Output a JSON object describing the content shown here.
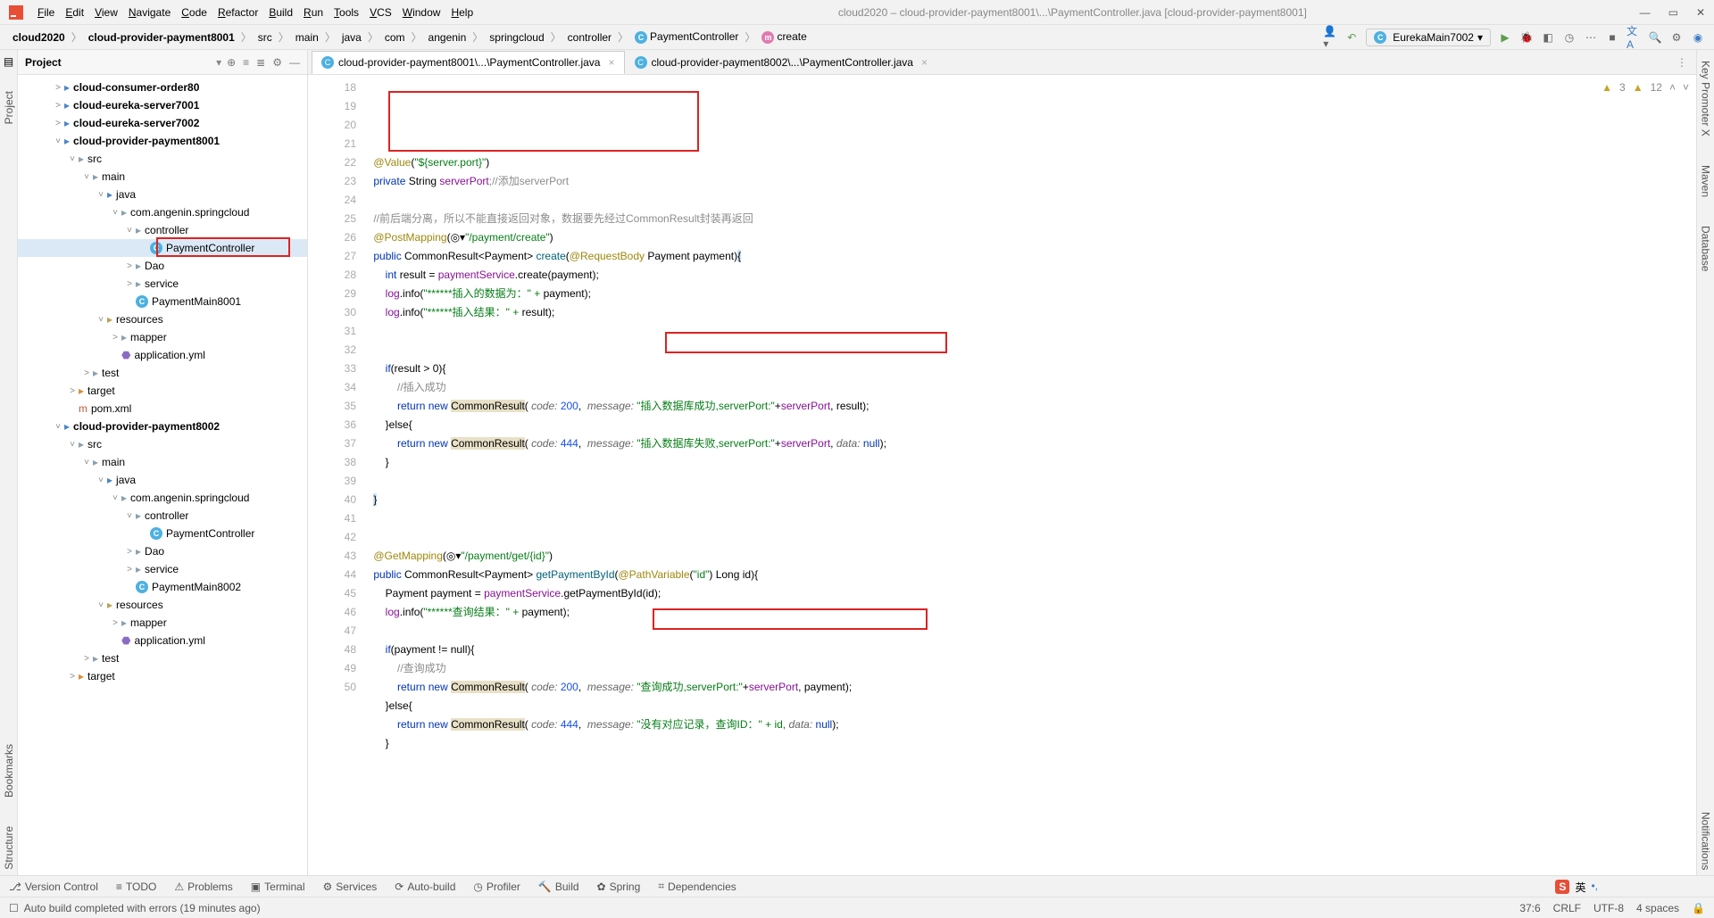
{
  "menu": {
    "items": [
      "File",
      "Edit",
      "View",
      "Navigate",
      "Code",
      "Refactor",
      "Build",
      "Run",
      "Tools",
      "VCS",
      "Window",
      "Help"
    ],
    "title": "cloud2020 – cloud-provider-payment8001\\...\\PaymentController.java [cloud-provider-payment8001]"
  },
  "crumbs": [
    "cloud2020",
    "cloud-provider-payment8001",
    "src",
    "main",
    "java",
    "com",
    "angenin",
    "springcloud",
    "controller",
    "PaymentController",
    "create"
  ],
  "run_config": "EurekaMain7002",
  "project_header": "Project",
  "left_tabs": [
    "Project",
    "Bookmarks",
    "Structure"
  ],
  "right_tabs": [
    "Key Promoter X",
    "Maven",
    "Database",
    "Notifications"
  ],
  "tree": [
    {
      "d": 2,
      "a": ">",
      "i": "folder-src",
      "t": "cloud-consumer-order80",
      "bold": true
    },
    {
      "d": 2,
      "a": ">",
      "i": "folder-src",
      "t": "cloud-eureka-server7001",
      "bold": true
    },
    {
      "d": 2,
      "a": ">",
      "i": "folder-src",
      "t": "cloud-eureka-server7002",
      "bold": true
    },
    {
      "d": 2,
      "a": "v",
      "i": "folder-src",
      "t": "cloud-provider-payment8001",
      "bold": true
    },
    {
      "d": 3,
      "a": "v",
      "i": "folder",
      "t": "src"
    },
    {
      "d": 4,
      "a": "v",
      "i": "folder",
      "t": "main"
    },
    {
      "d": 5,
      "a": "v",
      "i": "folder-src",
      "t": "java"
    },
    {
      "d": 6,
      "a": "v",
      "i": "folder",
      "t": "com.angenin.springcloud"
    },
    {
      "d": 7,
      "a": "v",
      "i": "folder",
      "t": "controller"
    },
    {
      "d": 8,
      "a": "",
      "i": "file-c",
      "t": "PaymentController",
      "sel": true,
      "red": true
    },
    {
      "d": 7,
      "a": ">",
      "i": "folder",
      "t": "Dao"
    },
    {
      "d": 7,
      "a": ">",
      "i": "folder",
      "t": "service"
    },
    {
      "d": 7,
      "a": "",
      "i": "file-c",
      "t": "PaymentMain8001"
    },
    {
      "d": 5,
      "a": "v",
      "i": "folder-res",
      "t": "resources"
    },
    {
      "d": 6,
      "a": ">",
      "i": "folder",
      "t": "mapper"
    },
    {
      "d": 6,
      "a": "",
      "i": "file-yml",
      "t": "application.yml"
    },
    {
      "d": 4,
      "a": ">",
      "i": "folder",
      "t": "test"
    },
    {
      "d": 3,
      "a": ">",
      "i": "folder-ex",
      "t": "target"
    },
    {
      "d": 3,
      "a": "",
      "i": "file-m",
      "t": "pom.xml"
    },
    {
      "d": 2,
      "a": "v",
      "i": "folder-src",
      "t": "cloud-provider-payment8002",
      "bold": true
    },
    {
      "d": 3,
      "a": "v",
      "i": "folder",
      "t": "src"
    },
    {
      "d": 4,
      "a": "v",
      "i": "folder",
      "t": "main"
    },
    {
      "d": 5,
      "a": "v",
      "i": "folder-src",
      "t": "java"
    },
    {
      "d": 6,
      "a": "v",
      "i": "folder",
      "t": "com.angenin.springcloud"
    },
    {
      "d": 7,
      "a": "v",
      "i": "folder",
      "t": "controller"
    },
    {
      "d": 8,
      "a": "",
      "i": "file-c",
      "t": "PaymentController"
    },
    {
      "d": 7,
      "a": ">",
      "i": "folder",
      "t": "Dao"
    },
    {
      "d": 7,
      "a": ">",
      "i": "folder",
      "t": "service"
    },
    {
      "d": 7,
      "a": "",
      "i": "file-c",
      "t": "PaymentMain8002"
    },
    {
      "d": 5,
      "a": "v",
      "i": "folder-res",
      "t": "resources"
    },
    {
      "d": 6,
      "a": ">",
      "i": "folder",
      "t": "mapper"
    },
    {
      "d": 6,
      "a": "",
      "i": "file-yml",
      "t": "application.yml"
    },
    {
      "d": 4,
      "a": ">",
      "i": "folder",
      "t": "test"
    },
    {
      "d": 3,
      "a": ">",
      "i": "folder-ex",
      "t": "target"
    }
  ],
  "editor_tabs": [
    {
      "label": "cloud-provider-payment8001\\...\\PaymentController.java",
      "active": true
    },
    {
      "label": "cloud-provider-payment8002\\...\\PaymentController.java",
      "active": false
    }
  ],
  "inspections": {
    "hint": "3",
    "warn": "12"
  },
  "line_start": 18,
  "line_end": 50,
  "status_tools": [
    "Version Control",
    "TODO",
    "Problems",
    "Terminal",
    "Services",
    "Auto-build",
    "Profiler",
    "Build",
    "Spring",
    "Dependencies"
  ],
  "status_msg": "Auto build completed with errors (19 minutes ago)",
  "status_right": [
    "37:6",
    "CRLF",
    "UTF-8",
    "4 spaces"
  ],
  "code": {
    "ann_value": "@Value",
    "value_str": "\"${server.port}\"",
    "private": "private",
    "string": "String",
    "serverPort": "serverPort",
    "cmt_add": ";//添加serverPort",
    "cmt_split": "//前后端分离，所以不能直接返回对象，数据要先经过CommonResult封装再返回",
    "postmap": "@PostMapping",
    "post_path": "\"/payment/create\"",
    "public": "public",
    "commonresult": "CommonResult",
    "payment_t": "Payment",
    "create": "create",
    "reqbody": "@RequestBody",
    "payment_p": "payment",
    "int": "int",
    "result": "result",
    "ps": "paymentService",
    "dot_create": ".create(",
    "close_p": ");",
    "log": "log",
    "info": ".info(",
    "s1": "\"******插入的数据为：\" + ",
    "s2": "\"******插入结果：\" + ",
    "if": "if",
    "gt0": "(result > 0){",
    "cmt_ok": "//插入成功",
    "return": "return",
    "new": "new",
    "commonresult_hl": "CommonResult",
    "open_p": "(",
    "code_p": "code:",
    "c200": "200",
    "c444": "444",
    "msg_p": "message:",
    "msg_ins_ok": "\"插入数据库成功,serverPort:\"",
    "plus_sp": "+serverPort",
    "comma_result": ", result);",
    "else": "}else{",
    "msg_ins_fail": "\"插入数据库失败,serverPort:\"",
    "data_p": "data:",
    "null": "null",
    "close2": ");",
    "getmap": "@GetMapping",
    "get_path": "\"/payment/get/{id}\"",
    "getbyid": "getPaymentById",
    "pathvar": "@PathVariable",
    "id_str": "\"id\"",
    "long": "Long",
    "id": "id",
    "decl_p": "Payment payment = ",
    "get_call": ".getPaymentById(id);",
    "s3": "\"******查询结果：\" + ",
    "if_pnull": "(payment != null){",
    "cmt_qok": "//查询成功",
    "msg_q_ok": "\"查询成功,serverPort:\"",
    "comma_payment": ", payment);",
    "msg_q_fail": "\"没有对应记录，查询ID：\" + id, "
  }
}
